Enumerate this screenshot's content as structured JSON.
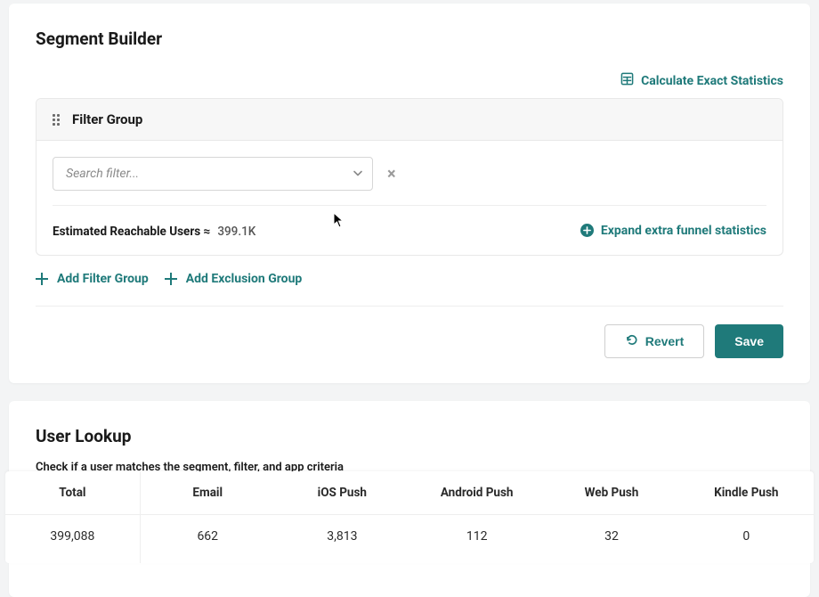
{
  "segmentBuilder": {
    "title": "Segment Builder",
    "calcStats": "Calculate Exact Statistics",
    "filterGroup": {
      "title": "Filter Group",
      "searchPlaceholder": "Search filter...",
      "estimatedLabel": "Estimated Reachable Users ≈",
      "estimatedValue": "399.1K",
      "expandFunnel": "Expand extra funnel statistics"
    },
    "addFilterGroup": "Add Filter Group",
    "addExclusionGroup": "Add Exclusion Group",
    "revert": "Revert",
    "save": "Save"
  },
  "userLookup": {
    "title": "User Lookup",
    "desc": "Check if a user matches the segment, filter, and app criteria"
  },
  "statsTable": {
    "headers": [
      "Total",
      "Email",
      "iOS Push",
      "Android Push",
      "Web Push",
      "Kindle Push"
    ],
    "values": [
      "399,088",
      "662",
      "3,813",
      "112",
      "32",
      "0"
    ]
  }
}
